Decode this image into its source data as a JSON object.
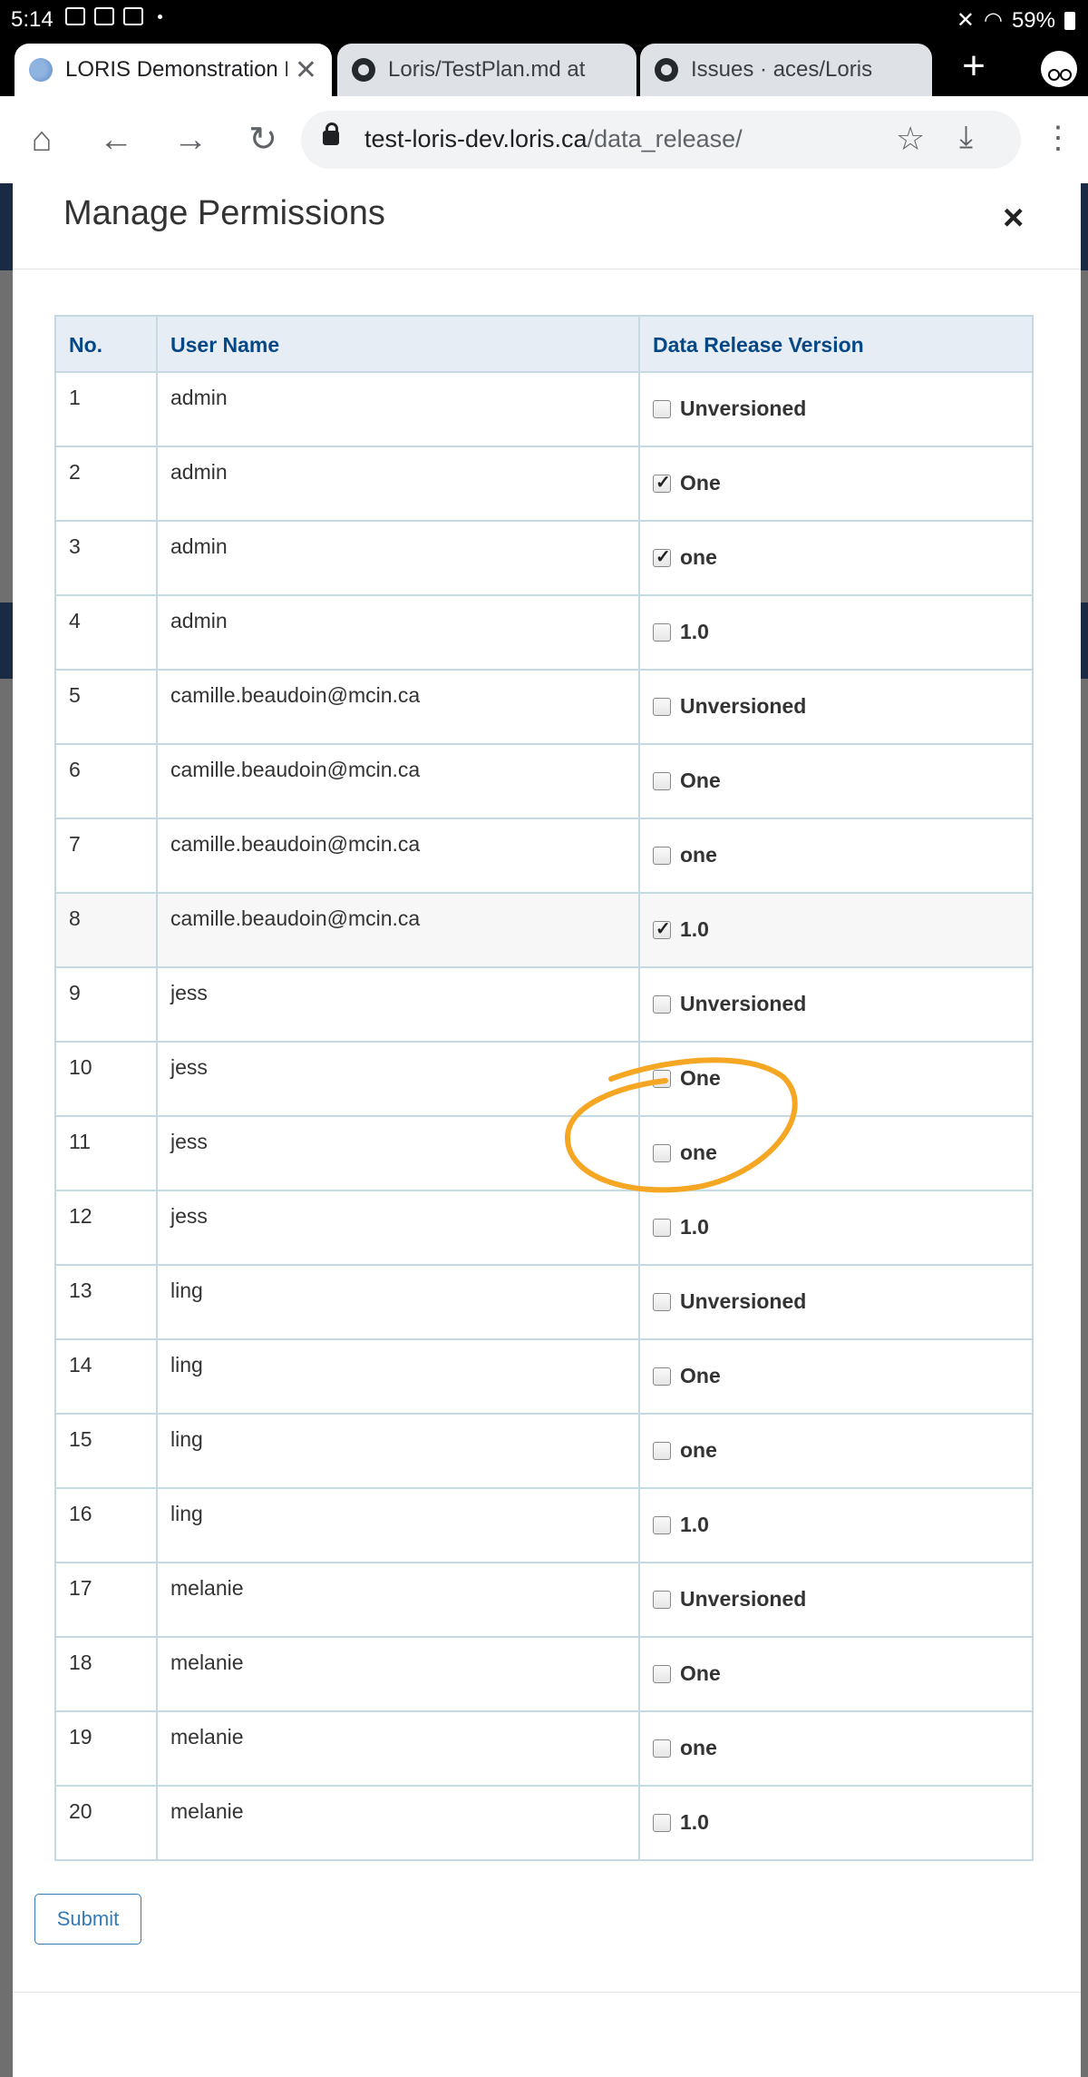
{
  "status_bar": {
    "time": "5:14",
    "battery": "59%"
  },
  "tabs": [
    {
      "title": "LORIS Demonstration D",
      "favicon": "brain-icon",
      "active": true
    },
    {
      "title": "Loris/TestPlan.md at",
      "favicon": "github-icon",
      "active": false
    },
    {
      "title": "Issues · aces/Loris",
      "favicon": "github-icon",
      "active": false
    }
  ],
  "toolbar": {
    "url_host": "test-loris-dev.loris.ca",
    "url_path": "/data_release/"
  },
  "modal": {
    "title": "Manage Permissions",
    "close_label": "×",
    "submit_label": "Submit"
  },
  "table": {
    "headers": [
      "No.",
      "User Name",
      "Data Release Version"
    ],
    "rows": [
      {
        "no": "1",
        "user": "admin",
        "version": "Unversioned",
        "checked": false
      },
      {
        "no": "2",
        "user": "admin",
        "version": "One",
        "checked": true
      },
      {
        "no": "3",
        "user": "admin",
        "version": "one",
        "checked": true
      },
      {
        "no": "4",
        "user": "admin",
        "version": "1.0",
        "checked": false
      },
      {
        "no": "5",
        "user": "camille.beaudoin@mcin.ca",
        "version": "Unversioned",
        "checked": false
      },
      {
        "no": "6",
        "user": "camille.beaudoin@mcin.ca",
        "version": "One",
        "checked": false
      },
      {
        "no": "7",
        "user": "camille.beaudoin@mcin.ca",
        "version": "one",
        "checked": false
      },
      {
        "no": "8",
        "user": "camille.beaudoin@mcin.ca",
        "version": "1.0",
        "checked": true
      },
      {
        "no": "9",
        "user": "jess",
        "version": "Unversioned",
        "checked": false
      },
      {
        "no": "10",
        "user": "jess",
        "version": "One",
        "checked": false
      },
      {
        "no": "11",
        "user": "jess",
        "version": "one",
        "checked": false
      },
      {
        "no": "12",
        "user": "jess",
        "version": "1.0",
        "checked": false
      },
      {
        "no": "13",
        "user": "ling",
        "version": "Unversioned",
        "checked": false
      },
      {
        "no": "14",
        "user": "ling",
        "version": "One",
        "checked": false
      },
      {
        "no": "15",
        "user": "ling",
        "version": "one",
        "checked": false
      },
      {
        "no": "16",
        "user": "ling",
        "version": "1.0",
        "checked": false
      },
      {
        "no": "17",
        "user": "melanie",
        "version": "Unversioned",
        "checked": false
      },
      {
        "no": "18",
        "user": "melanie",
        "version": "One",
        "checked": false
      },
      {
        "no": "19",
        "user": "melanie",
        "version": "one",
        "checked": false
      },
      {
        "no": "20",
        "user": "melanie",
        "version": "1.0",
        "checked": false
      }
    ]
  },
  "colors": {
    "header_text": "#064785",
    "header_bg": "#e6edf5",
    "annotation": "#f5a623",
    "button_accent": "#337ab7"
  }
}
